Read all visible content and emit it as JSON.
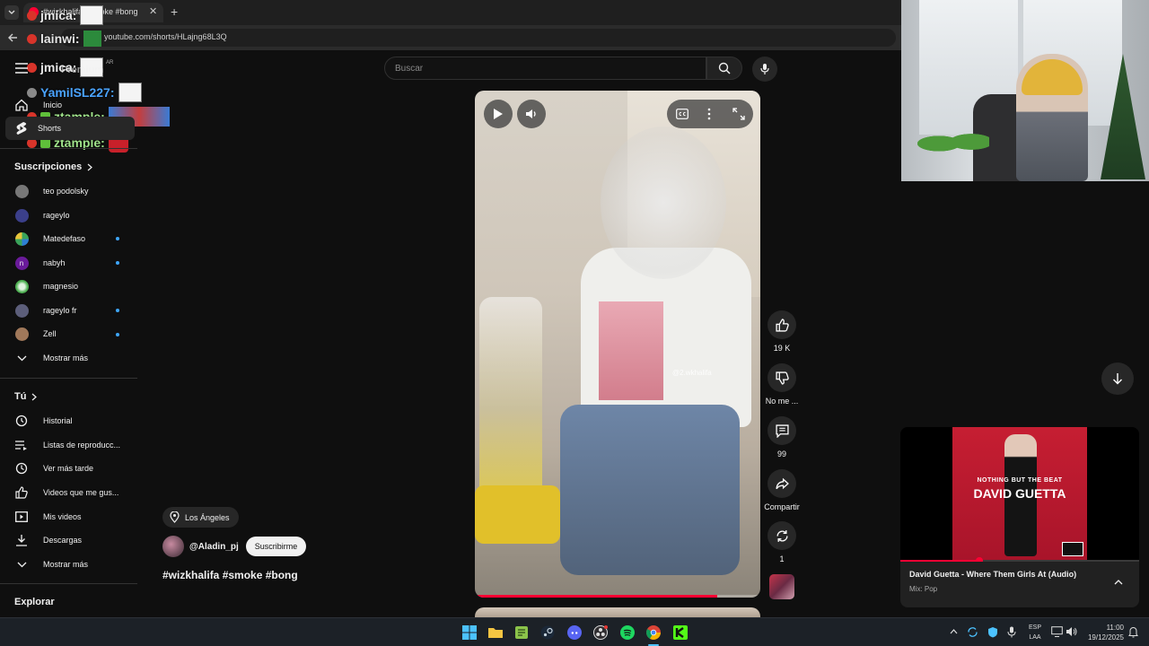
{
  "browser": {
    "tab_title": "#wizkhalifa #smoke #bong",
    "url": "youtube.com/shorts/HLajng68L3Q",
    "new_tab_label": "+"
  },
  "chat_overlay": [
    {
      "user": "jmica:"
    },
    {
      "user": "lainwi:"
    },
    {
      "user": "jmica:"
    },
    {
      "user": "YamilSL227:"
    },
    {
      "user": "ztample:"
    },
    {
      "user": "ztample:"
    }
  ],
  "header": {
    "logo_text": "Premium",
    "logo_badge": "AR",
    "search_placeholder": "Buscar"
  },
  "sidebar": {
    "main": [
      {
        "label": "Inicio",
        "icon": "home-icon"
      },
      {
        "label": "Shorts",
        "icon": "shorts-icon"
      }
    ],
    "subscriptions_title": "Suscripciones",
    "subscriptions": [
      {
        "label": "teo podolsky",
        "color": "#777777",
        "new": false
      },
      {
        "label": "rageylo",
        "color": "#3b3f8a",
        "new": false
      },
      {
        "label": "Matedefaso",
        "color": "#3aa35a",
        "new": true
      },
      {
        "label": "nabyh",
        "color": "#6a1b9a",
        "new": true,
        "initial": "n"
      },
      {
        "label": "magnesio",
        "color": "#4caf50",
        "new": false
      },
      {
        "label": "rageylo fr",
        "color": "#5c5e7a",
        "new": true
      },
      {
        "label": "Zell",
        "color": "#a0785a",
        "new": true
      }
    ],
    "subs_more": "Mostrar más",
    "you_title": "Tú",
    "you_items": [
      {
        "label": "Historial",
        "icon": "history-icon"
      },
      {
        "label": "Listas de reproducc...",
        "icon": "playlists-icon"
      },
      {
        "label": "Ver más tarde",
        "icon": "watch-later-icon"
      },
      {
        "label": "Videos que me gus...",
        "icon": "liked-videos-icon"
      },
      {
        "label": "Mis videos",
        "icon": "my-videos-icon"
      },
      {
        "label": "Descargas",
        "icon": "downloads-icon"
      },
      {
        "label": "Mostrar más",
        "icon": "chevron-down-icon"
      }
    ],
    "explore_title": "Explorar"
  },
  "short": {
    "location": "Los Ángeles",
    "channel": "@Aladin_pj",
    "subscribe_label": "Suscribirme",
    "title": "#wizkhalifa #smoke #bong",
    "watermark": "@2.wkhalifa",
    "actions": {
      "likes": "19 K",
      "dislike_label": "No me ...",
      "comments": "99",
      "share_label": "Compartir",
      "remix_count": "1"
    }
  },
  "music": {
    "album_line1": "NOTHING BUT THE BEAT",
    "album_artist": "DAVID GUETTA",
    "title": "David Guetta - Where Them Girls At (Audio)",
    "subtitle": "Mix: Pop",
    "progress": 0.33
  },
  "taskbar": {
    "lang": "ESP",
    "layout": "LAA",
    "time": "11:00",
    "date": "19/12/2025"
  },
  "colors": {
    "accent_red": "#ff0033",
    "link_blue": "#3ea6ff"
  }
}
